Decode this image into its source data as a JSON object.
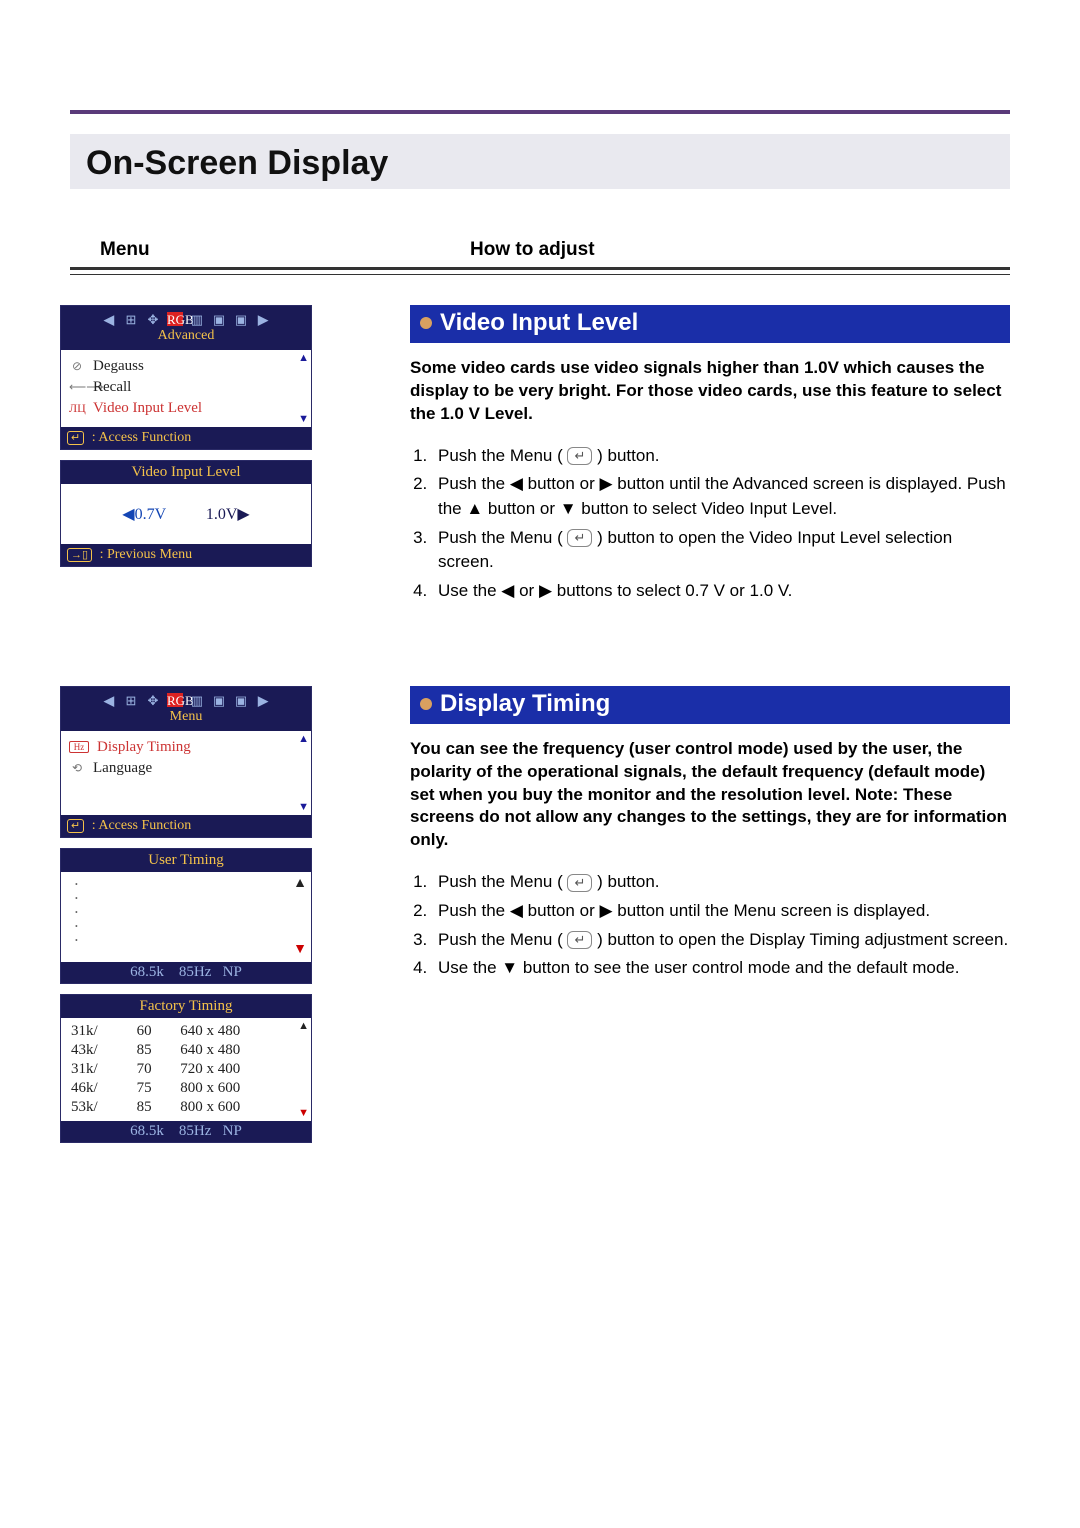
{
  "page_title": "On-Screen Display",
  "columns": {
    "menu": "Menu",
    "howto": "How to adjust"
  },
  "osd1": {
    "top_label": "Advanced",
    "items": [
      {
        "icon": "⊘",
        "label": "Degauss",
        "selected": false
      },
      {
        "icon": "⟵⟶",
        "label": "Recall",
        "selected": false
      },
      {
        "icon": "ЛЦ",
        "label": "Video Input Level",
        "selected": true
      }
    ],
    "hint": "Access Function",
    "value_title": "Video Input Level",
    "value_left": "0.7V",
    "value_right": "1.0V",
    "prev_hint": "Previous Menu"
  },
  "section1": {
    "title": "Video Input Level",
    "intro": "Some video cards use video signals higher than 1.0V which causes the display to be very bright. For those video cards, use this feature to select the 1.0 V Level.",
    "steps": {
      "s1a": "Push the Menu (",
      "s1b": ") button.",
      "s2": "Push the ◀ button or ▶ button until the Advanced screen is displayed. Push the ▲ button or ▼ button to select Video Input Level.",
      "s3a": "Push the Menu (",
      "s3b": ") button to open the Video Input Level selection screen.",
      "s4": "Use the  ◀ or ▶ buttons to select 0.7 V or 1.0 V."
    }
  },
  "osd2": {
    "top_label": "Menu",
    "items": [
      {
        "icon": "Hz",
        "label": "Display Timing",
        "selected": true
      },
      {
        "icon": "⟲",
        "label": "Language",
        "selected": false
      }
    ],
    "hint": "Access Function",
    "user_title": "User Timing",
    "user_status": {
      "freq": "68.5k",
      "hz": "85Hz",
      "pol": "NP"
    },
    "factory_title": "Factory Timing",
    "factory_rows": [
      {
        "k": "31k/",
        "r": "60",
        "res": "640 x 480"
      },
      {
        "k": "43k/",
        "r": "85",
        "res": "640 x 480"
      },
      {
        "k": "31k/",
        "r": "70",
        "res": "720 x 400"
      },
      {
        "k": "46k/",
        "r": "75",
        "res": "800 x 600"
      },
      {
        "k": "53k/",
        "r": "85",
        "res": "800 x 600"
      }
    ],
    "factory_status": {
      "freq": "68.5k",
      "hz": "85Hz",
      "pol": "NP"
    }
  },
  "section2": {
    "title": "Display Timing",
    "intro": "You can see the frequency (user control mode) used by the user, the polarity of the operational signals, the default frequency (default mode) set when you buy the monitor and the resolution level. Note: These screens do not allow any changes to the settings, they are for information only.",
    "steps": {
      "s1a": "Push the Menu (",
      "s1b": ") button.",
      "s2": "Push the ◀ button or ▶ button until the Menu screen is displayed.",
      "s3a": "Push the Menu (",
      "s3b": ") button to open the Display Timing adjustment screen.",
      "s4": "Use the ▼ button to see the user control mode and the default mode."
    }
  },
  "chart_data": {
    "type": "table",
    "title": "Factory Timing",
    "columns": [
      "horiz_kHz",
      "vert_Hz",
      "resolution"
    ],
    "rows": [
      [
        "31k",
        60,
        "640 x 480"
      ],
      [
        "43k",
        85,
        "640 x 480"
      ],
      [
        "31k",
        70,
        "720 x 400"
      ],
      [
        "46k",
        75,
        "800 x 600"
      ],
      [
        "53k",
        85,
        "800 x 600"
      ]
    ],
    "current_mode": {
      "horiz_kHz": "68.5k",
      "vert_Hz": 85,
      "polarity": "NP"
    }
  }
}
